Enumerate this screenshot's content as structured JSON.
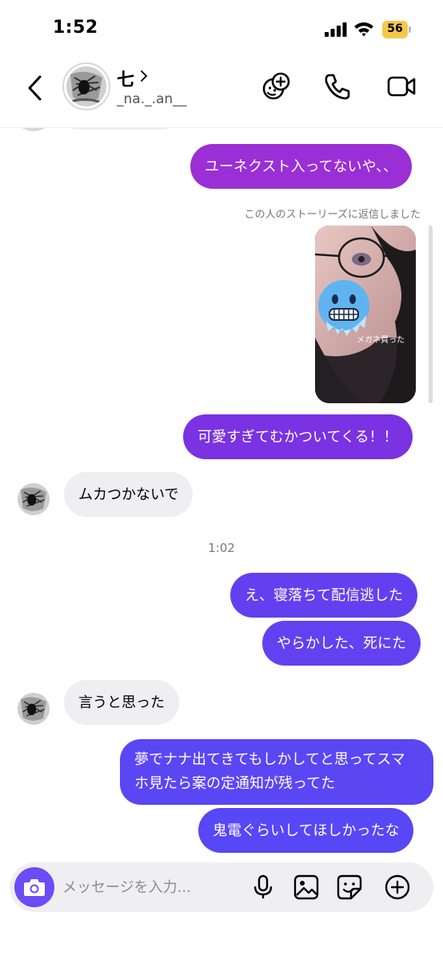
{
  "status_bar": {
    "time": "1:52",
    "battery": "56"
  },
  "header": {
    "contact_name": "七",
    "username": "_na._.an__",
    "icons": [
      "back-icon",
      "chevron-right-icon",
      "effects-icon",
      "phone-icon",
      "video-icon"
    ]
  },
  "messages": {
    "m1": "ユーネクスト入ってないや、、",
    "story_reply_label": "この人のストーリーズに返信しました",
    "story_caption": "メガネ買った",
    "m2": "可愛すぎてむかついてくる！！",
    "m3": "ムカつかないで",
    "time_separator": "1:02",
    "m4": "え、寝落ちて配信逃した",
    "m5": "やらかした、死にた",
    "m6": "言うと思った",
    "m7": "夢でナナ出てきてもしかしてと思ってスマホ見たら案の定通知が残ってた",
    "m8": "鬼電ぐらいしてほしかったな"
  },
  "composer": {
    "placeholder": "メッセージを入力...",
    "icons": [
      "camera-icon",
      "microphone-icon",
      "gallery-icon",
      "sticker-icon",
      "add-icon"
    ]
  },
  "colors": {
    "bubble_purple": "#8a2bd9",
    "bubble_violet": "#6b3ff0",
    "bubble_blue_violet": "#5a45f5",
    "received_bg": "#efeff1",
    "composer_camera": "#6b4cf6",
    "battery": "#f4c84b"
  }
}
